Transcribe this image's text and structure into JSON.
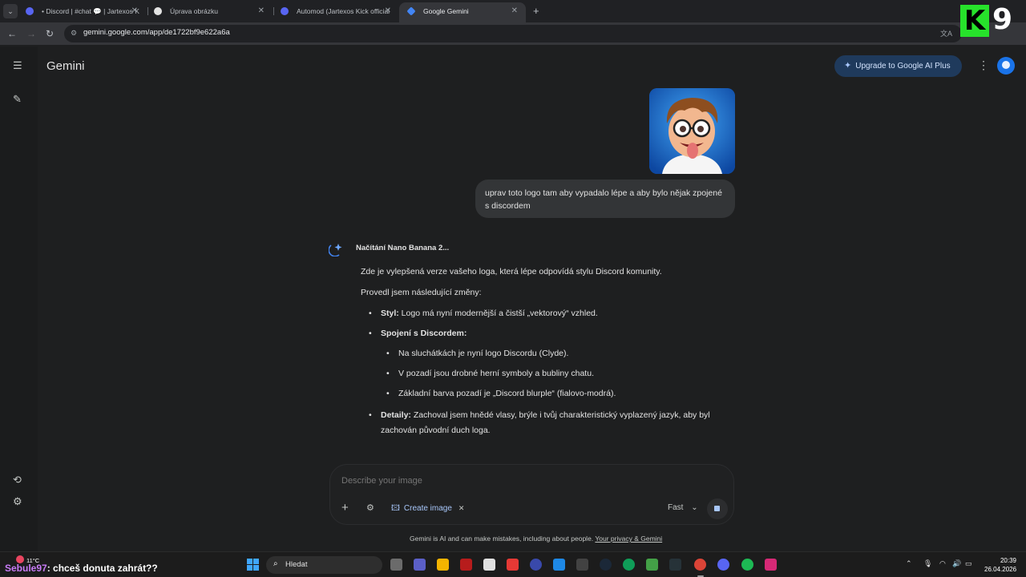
{
  "browser": {
    "tabs": [
      {
        "title": "• Discord | #chat 💬 | Jartexos K",
        "favicon_color": "#5865f2",
        "active": false
      },
      {
        "title": "Úprava obrázku",
        "favicon_color": "#e3e3e3",
        "active": false
      },
      {
        "title": "Automod (Jartexos Kick official",
        "favicon_color": "#5865f2",
        "active": false
      },
      {
        "title": "Google Gemini",
        "favicon_color": "#4285f4",
        "active": true
      }
    ],
    "url": "gemini.google.com/app/de1722bf9e622a6a"
  },
  "overlay": {
    "logo_k": "K",
    "logo_9": "9",
    "chat_user": "Sebule97",
    "chat_message": ": chceš donuta zahrát??"
  },
  "header": {
    "title": "Gemini",
    "upgrade_label": "Upgrade to Google AI Plus"
  },
  "conversation": {
    "user_message": "uprav toto logo tam aby vypadalo lépe a aby bylo nějak zpojené s discordem",
    "response_status": "Načítání Nano Banana 2...",
    "intro": "Zde je vylepšená verze vašeho loga, která lépe odpovídá stylu Discord komunity.",
    "changes_intro": "Provedl jsem následující změny:",
    "bullets": {
      "styl_label": "Styl:",
      "styl_text": " Logo má nyní modernější a čistší „vektorový“ vzhled.",
      "spojeni_label": "Spojení s Discordem:",
      "sub1": "Na sluchátkách je nyní logo Discordu (Clyde).",
      "sub2": "V pozadí jsou drobné herní symboly a bubliny chatu.",
      "sub3": "Základní barva pozadí je „Discord blurple“ (fialovo-modrá).",
      "detaily_label": "Detaily:",
      "detaily_text": " Zachoval jsem hnědé vlasy, brýle i tvůj charakteristický vyplazený jazyk, aby byl zachován původní duch loga."
    }
  },
  "composer": {
    "placeholder": "Describe your image",
    "create_image_label": "Create image",
    "mode_label": "Fast"
  },
  "disclaimer": {
    "text": "Gemini is AI and can make mistakes, including about people. ",
    "link": "Your privacy & Gemini"
  },
  "taskbar": {
    "temperature": "11°C",
    "search_label": "Hledat",
    "time": "20:39",
    "date": "26.04.2026"
  },
  "colors": {
    "accent": "#a8c7fa",
    "upgrade_bg": "#1f3a5c",
    "bubble_bg": "#333537",
    "k9_green": "#27e22b",
    "chat_user": "#c97cf8"
  }
}
